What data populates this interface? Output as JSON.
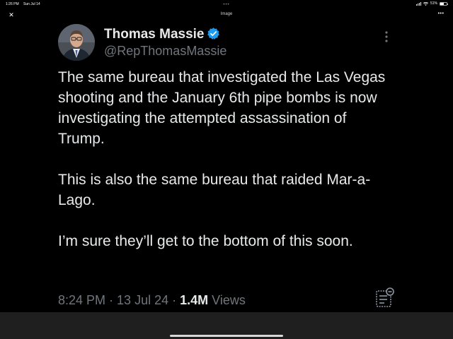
{
  "status_bar": {
    "time": "1:26 PM",
    "date": "Sun Jul 14",
    "battery_text": "51%",
    "battery_level": 0.51
  },
  "toolbar": {
    "title": "Image",
    "close_glyph": "✕",
    "more_glyph": "•••",
    "top_dots": "•••"
  },
  "tweet": {
    "author_name": "Thomas Massie",
    "author_handle": "@RepThomasMassie",
    "verified_color": "#1d9bf0",
    "paragraphs": [
      "The same bureau that investigated the Las Vegas shooting and the January 6th pipe bombs is now investigating the attempted assassination of Trump.",
      "This is also the same bureau that raided Mar-a-Lago.",
      "I’m sure they’ll get to the bottom of this soon."
    ],
    "time": "8:24 PM",
    "separator": " · ",
    "date": "13 Jul 24",
    "view_count": "1.4M",
    "views_label": " Views"
  },
  "icons": {
    "close": "close-icon",
    "more": "more-icon",
    "verified": "verified-badge-icon",
    "menu": "vertical-dots-icon",
    "analytics": "analytics-icon",
    "wifi": "wifi-icon",
    "battery": "battery-icon"
  }
}
